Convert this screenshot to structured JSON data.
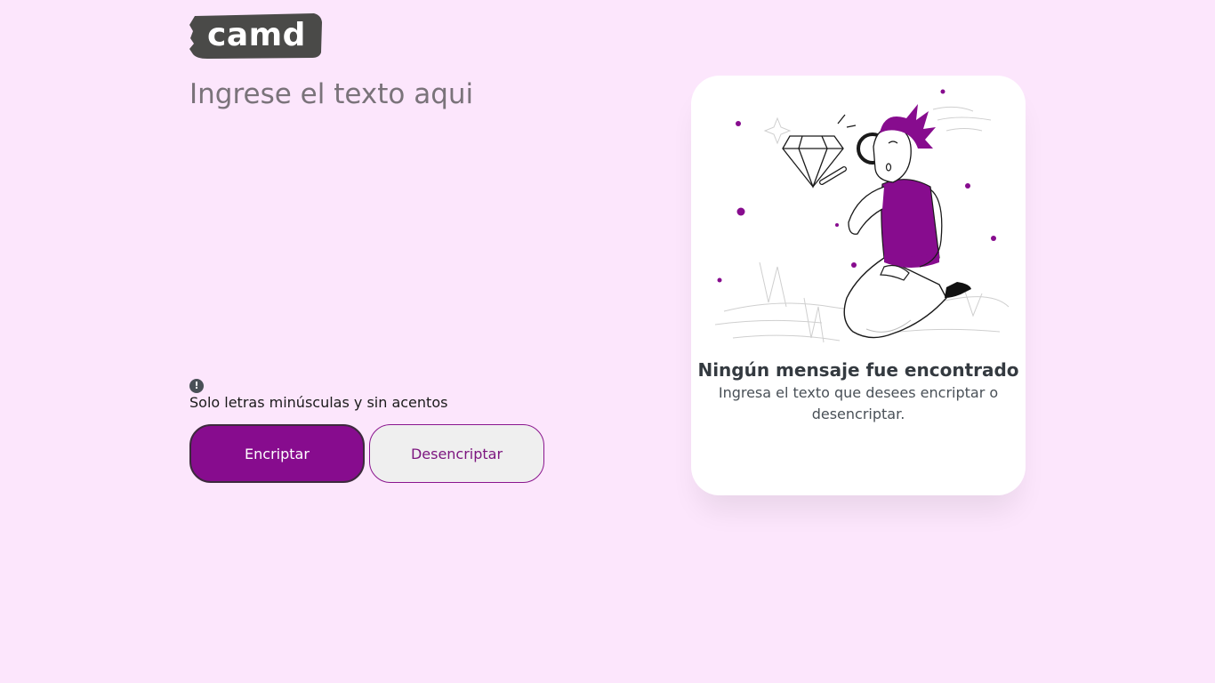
{
  "logo": {
    "text": "camd"
  },
  "input": {
    "placeholder": "Ingrese el texto aqui",
    "value": ""
  },
  "hint": {
    "icon": "exclamation-icon",
    "icon_glyph": "!",
    "text": "Solo letras minúsculas y sin acentos"
  },
  "buttons": {
    "encrypt_label": "Encriptar",
    "decrypt_label": "Desencriptar"
  },
  "result": {
    "title": "Ningún mensaje fue encontrado",
    "subtitle": "Ingresa el texto que desees encriptar o desencriptar.",
    "illustration": "person-with-magnifier-diamond-illustration"
  },
  "colors": {
    "background": "#fce6fc",
    "primary": "#870c8e",
    "secondary_bg": "#efefef",
    "card": "#ffffff",
    "logo_bg": "#4a4a48"
  }
}
